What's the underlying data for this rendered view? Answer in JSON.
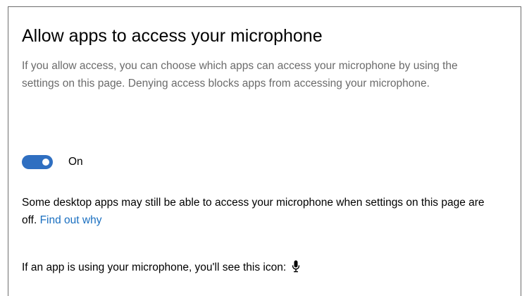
{
  "section": {
    "title": "Allow apps to access your microphone",
    "description": "If you allow access, you can choose which apps can access your microphone by using the settings on this page. Denying access blocks apps from accessing your microphone."
  },
  "toggle": {
    "state_label": "On",
    "is_on": true,
    "accent_color": "#2f6fc1"
  },
  "note": {
    "text": "Some desktop apps may still be able to access your microphone when settings on this page are off.",
    "link_label": "Find out why",
    "link_color": "#1a6fc0"
  },
  "icon_info": {
    "text": "If an app is using your microphone, you'll see this icon:",
    "icon": "microphone-icon"
  }
}
